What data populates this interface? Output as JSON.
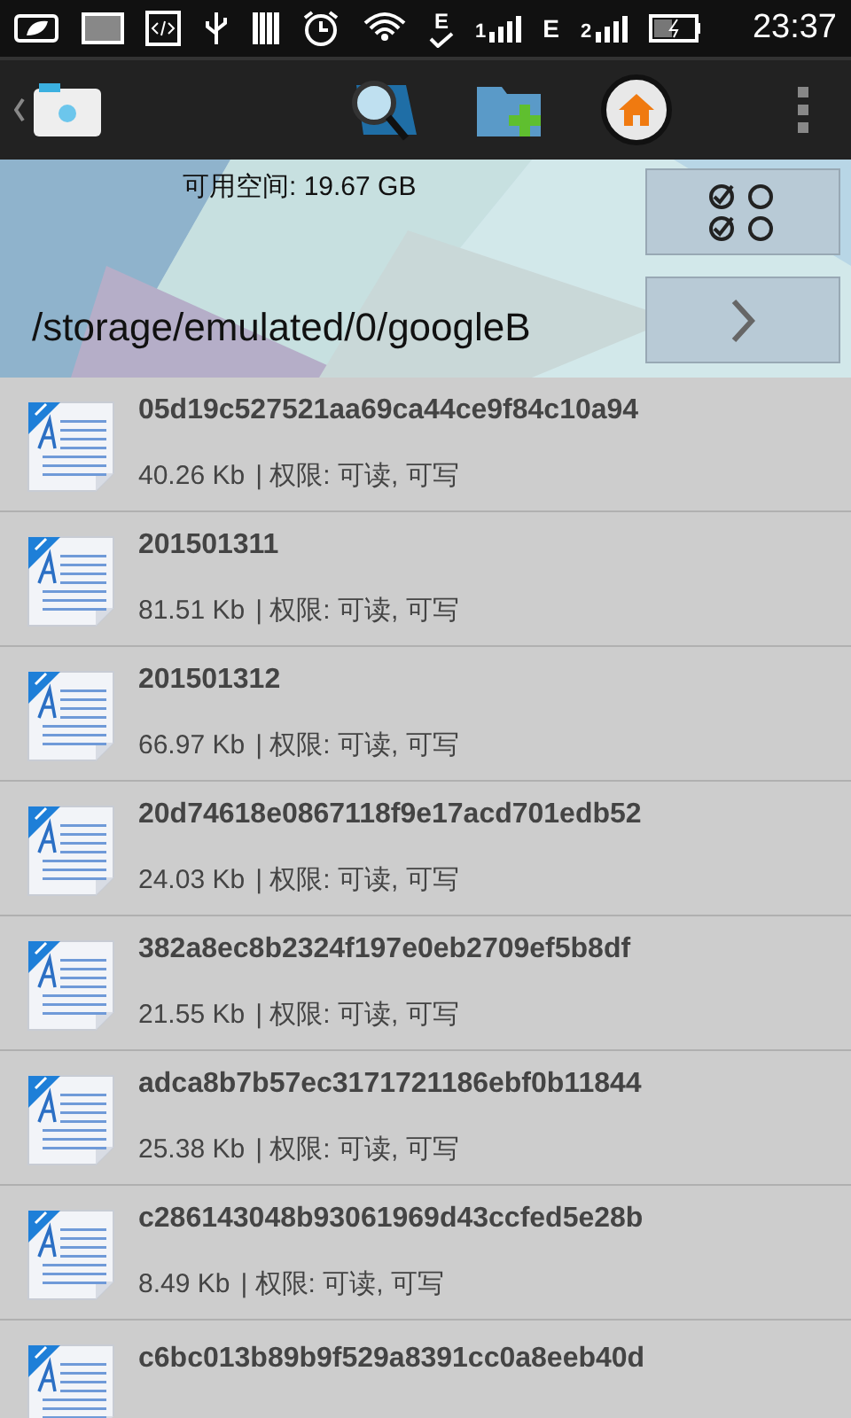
{
  "status_bar": {
    "network_letters": [
      "E",
      "E"
    ],
    "signal_slots": [
      "1",
      "2"
    ],
    "time": "23:37"
  },
  "header": {
    "free_space": "可用空间: 19.67 GB",
    "path": "/storage/emulated/0/googleB"
  },
  "files": [
    {
      "name": "05d19c527521aa69ca44ce9f84c10a94",
      "size": "40.26 Kb",
      "permissions": "| 权限: 可读, 可写"
    },
    {
      "name": "201501311",
      "size": "81.51 Kb",
      "permissions": "| 权限: 可读, 可写"
    },
    {
      "name": "201501312",
      "size": "66.97 Kb",
      "permissions": "| 权限: 可读, 可写"
    },
    {
      "name": "20d74618e0867118f9e17acd701edb52",
      "size": "24.03 Kb",
      "permissions": "| 权限: 可读, 可写"
    },
    {
      "name": "382a8ec8b2324f197e0eb2709ef5b8df",
      "size": "21.55 Kb",
      "permissions": "| 权限: 可读, 可写"
    },
    {
      "name": "adca8b7b57ec3171721186ebf0b11844",
      "size": "25.38 Kb",
      "permissions": "| 权限: 可读, 可写"
    },
    {
      "name": "c286143048b93061969d43ccfed5e28b",
      "size": "8.49 Kb",
      "permissions": "| 权限: 可读, 可写"
    },
    {
      "name": "c6bc013b89b9f529a8391cc0a8eeb40d"
    }
  ]
}
